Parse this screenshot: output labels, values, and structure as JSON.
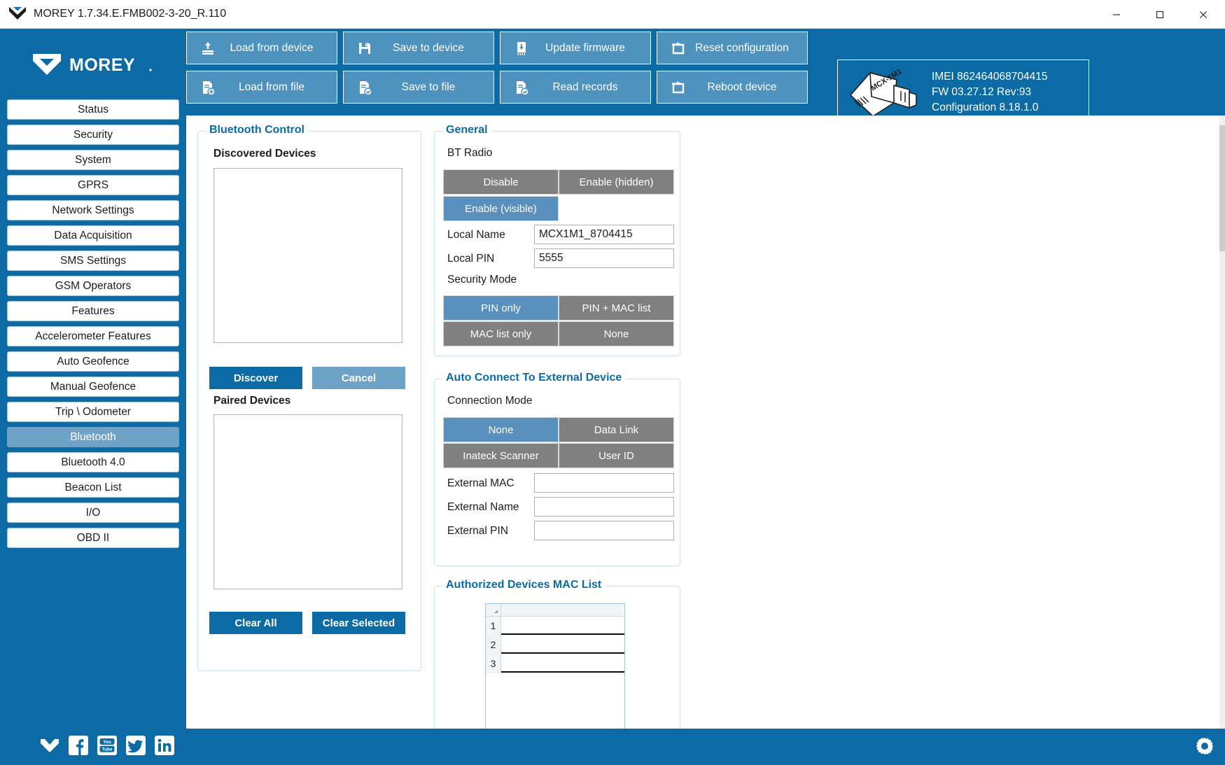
{
  "window": {
    "title": "MOREY 1.7.34.E.FMB002-3-20_R.110",
    "minimize": "─",
    "maximize": "☐",
    "close": "✕"
  },
  "brand": {
    "name": "MOREY"
  },
  "toolbar": {
    "buttons": [
      {
        "label": "Load from device",
        "icon": "upload-to-tray-icon"
      },
      {
        "label": "Save to device",
        "icon": "floppy-disk-icon"
      },
      {
        "label": "Update firmware",
        "icon": "firmware-chip-icon"
      },
      {
        "label": "Reset configuration",
        "icon": "reset-arrow-icon"
      },
      {
        "label": "Load from file",
        "icon": "file-load-icon"
      },
      {
        "label": "Save to file",
        "icon": "file-save-icon"
      },
      {
        "label": "Read records",
        "icon": "file-records-icon"
      },
      {
        "label": "Reboot device",
        "icon": "reboot-arrow-icon"
      }
    ]
  },
  "device": {
    "image_label": "MCX-1M1",
    "imei": "IMEI  862464068704415",
    "fw": "FW  03.27.12 Rev:93",
    "configuration": "Configuration  8.18.1.0"
  },
  "sidebar": {
    "items": [
      {
        "label": "Status",
        "active": false
      },
      {
        "label": "Security",
        "active": false
      },
      {
        "label": "System",
        "active": false
      },
      {
        "label": "GPRS",
        "active": false
      },
      {
        "label": "Network Settings",
        "active": false
      },
      {
        "label": "Data Acquisition",
        "active": false
      },
      {
        "label": "SMS Settings",
        "active": false
      },
      {
        "label": "GSM Operators",
        "active": false
      },
      {
        "label": "Features",
        "active": false
      },
      {
        "label": "Accelerometer Features",
        "active": false
      },
      {
        "label": "Auto Geofence",
        "active": false
      },
      {
        "label": "Manual Geofence",
        "active": false
      },
      {
        "label": "Trip \\ Odometer",
        "active": false
      },
      {
        "label": "Bluetooth",
        "active": true
      },
      {
        "label": "Bluetooth 4.0",
        "active": false
      },
      {
        "label": "Beacon List",
        "active": false
      },
      {
        "label": "I/O",
        "active": false
      },
      {
        "label": "OBD II",
        "active": false
      }
    ]
  },
  "bluetooth_control": {
    "title": "Bluetooth Control",
    "discovered_label": "Discovered Devices",
    "discovered_items": [],
    "discover_button": "Discover",
    "cancel_button": "Cancel",
    "paired_label": "Paired Devices",
    "paired_items": [],
    "clear_all_button": "Clear All",
    "clear_selected_button": "Clear Selected"
  },
  "general": {
    "title": "General",
    "bt_radio_label": "BT Radio",
    "bt_radio_options": [
      {
        "label": "Disable",
        "selected": false
      },
      {
        "label": "Enable (hidden)",
        "selected": false
      },
      {
        "label": "Enable (visible)",
        "selected": true
      }
    ],
    "local_name_label": "Local Name",
    "local_name_value": "MCX1M1_8704415",
    "local_pin_label": "Local PIN",
    "local_pin_value": "5555",
    "security_mode_label": "Security Mode",
    "security_mode_options": [
      {
        "label": "PIN only",
        "selected": true
      },
      {
        "label": "PIN + MAC list",
        "selected": false
      },
      {
        "label": "MAC list only",
        "selected": false
      },
      {
        "label": "None",
        "selected": false
      }
    ]
  },
  "auto_connect": {
    "title": "Auto Connect To External Device",
    "connection_mode_label": "Connection Mode",
    "connection_mode_options": [
      {
        "label": "None",
        "selected": true
      },
      {
        "label": "Data Link",
        "selected": false
      },
      {
        "label": "Inateck Scanner",
        "selected": false
      },
      {
        "label": "User ID",
        "selected": false
      }
    ],
    "external_mac_label": "External MAC",
    "external_mac_value": "",
    "external_name_label": "External Name",
    "external_name_value": "",
    "external_pin_label": "External PIN",
    "external_pin_value": ""
  },
  "authorized_mac_list": {
    "title": "Authorized Devices MAC List",
    "rows": [
      {
        "num": "1",
        "value": ""
      },
      {
        "num": "2",
        "value": ""
      },
      {
        "num": "3",
        "value": ""
      }
    ]
  },
  "footer": {
    "social": [
      {
        "name": "morey-mail-icon"
      },
      {
        "name": "facebook-icon"
      },
      {
        "name": "youtube-icon"
      },
      {
        "name": "twitter-icon"
      },
      {
        "name": "linkedin-icon"
      }
    ],
    "settings_icon": "gear-icon"
  },
  "colors": {
    "brand_blue": "#0c6aa5",
    "toolbar_button": "#4e92bf",
    "segment_off": "#808080",
    "segment_on": "#5a90bd",
    "active_nav": "#6ea2c6"
  }
}
